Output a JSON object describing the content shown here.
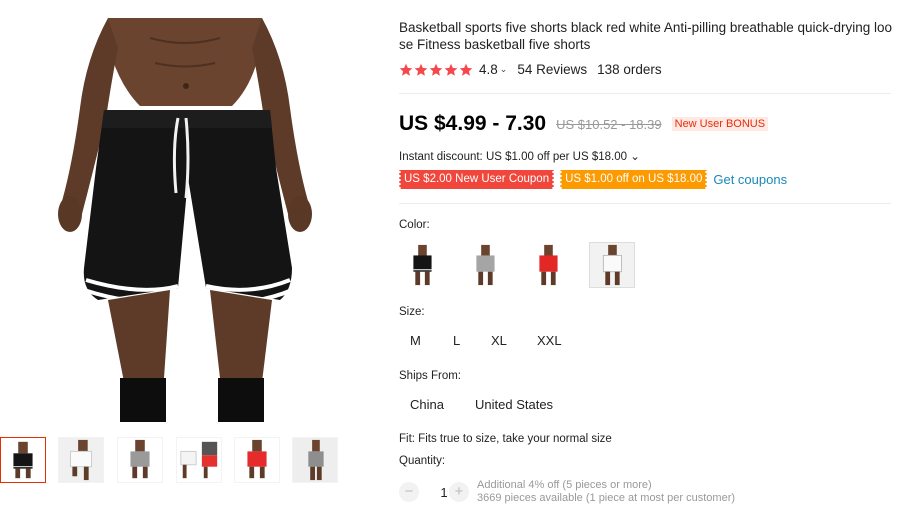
{
  "product": {
    "title": "Basketball sports five shorts black red white Anti-pilling breathable quick-drying loose Fitness basketball five shorts",
    "rating": "4.8",
    "rating_chevron": "⌄",
    "stars": 5,
    "reviews": "54 Reviews",
    "orders": "138 orders"
  },
  "price": {
    "current": "US $4.99 - 7.30",
    "original": "US $10.52 - 18.39",
    "badge": "New User BONUS"
  },
  "discount": {
    "text": "Instant discount: US $1.00 off per US $18.00 ⌄"
  },
  "coupons": {
    "new_user": "US $2.00 New User Coupon",
    "store": "US $1.00 off on US $18.00",
    "get_label": "Get coupons"
  },
  "color": {
    "label": "Color:",
    "options": [
      "black",
      "grey",
      "red",
      "white"
    ],
    "selected_index": 3
  },
  "size": {
    "label": "Size:",
    "options": [
      "M",
      "L",
      "XL",
      "XXL"
    ]
  },
  "ships_from": {
    "label": "Ships From:",
    "options": [
      "China",
      "United States"
    ]
  },
  "fit": "Fit: Fits true to size, take your normal size",
  "quantity": {
    "label": "Quantity:",
    "value": "1",
    "minus": "−",
    "plus": "+",
    "note1": "Additional 4% off (5 pieces or more)",
    "note2": "3669 pieces available (1 piece at most per customer)"
  },
  "colors": {
    "star": "#f5484d",
    "accent": "#e62e04",
    "link": "#1a88b9",
    "coupon_red": "#f1463b",
    "coupon_orange": "#fc9a00"
  },
  "gallery": {
    "thumbnails": [
      "black-shorts",
      "white-shorts",
      "grey-shorts",
      "white-red-combo",
      "red-shorts",
      "grey-shorts-side"
    ],
    "active_index": 0
  }
}
